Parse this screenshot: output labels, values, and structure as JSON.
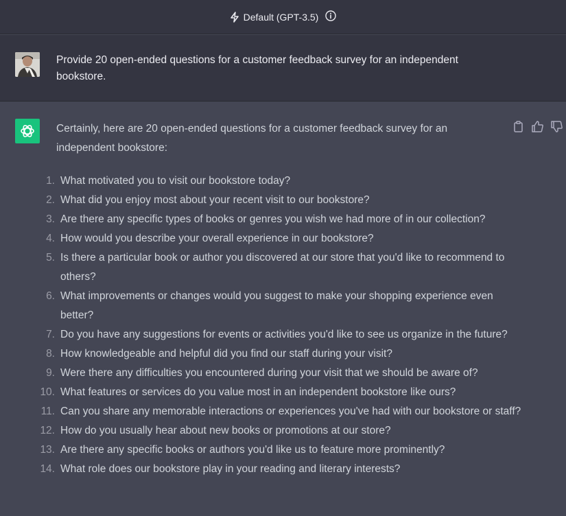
{
  "header": {
    "model_label": "Default (GPT-3.5)",
    "bolt_icon": "bolt-icon",
    "info_icon": "info-icon"
  },
  "user_message": {
    "text": "Provide 20 open-ended questions for a customer feedback survey for an independent bookstore."
  },
  "assistant_message": {
    "intro": "Certainly, here are 20 open-ended questions for a customer feedback survey for an independent bookstore:",
    "questions": [
      {
        "num": "1.",
        "text": "What motivated you to visit our bookstore today?"
      },
      {
        "num": "2.",
        "text": "What did you enjoy most about your recent visit to our bookstore?"
      },
      {
        "num": "3.",
        "text": "Are there any specific types of books or genres you wish we had more of in our collection?"
      },
      {
        "num": "4.",
        "text": "How would you describe your overall experience in our bookstore?"
      },
      {
        "num": "5.",
        "text": "Is there a particular book or author you discovered at our store that you'd like to recommend to others?"
      },
      {
        "num": "6.",
        "text": "What improvements or changes would you suggest to make your shopping experience even better?"
      },
      {
        "num": "7.",
        "text": "Do you have any suggestions for events or activities you'd like to see us organize in the future?"
      },
      {
        "num": "8.",
        "text": "How knowledgeable and helpful did you find our staff during your visit?"
      },
      {
        "num": "9.",
        "text": "Were there any difficulties you encountered during your visit that we should be aware of?"
      },
      {
        "num": "10.",
        "text": "What features or services do you value most in an independent bookstore like ours?"
      },
      {
        "num": "11.",
        "text": "Can you share any memorable interactions or experiences you've had with our bookstore or staff?"
      },
      {
        "num": "12.",
        "text": "How do you usually hear about new books or promotions at our store?"
      },
      {
        "num": "13.",
        "text": "Are there any specific books or authors you'd like us to feature more prominently?"
      },
      {
        "num": "14.",
        "text": "What role does our bookstore play in your reading and literary interests?"
      }
    ]
  },
  "colors": {
    "header_bg": "#343541",
    "assistant_bg": "#444654",
    "gpt_avatar": "#19c37d",
    "text": "#d1d5db"
  }
}
